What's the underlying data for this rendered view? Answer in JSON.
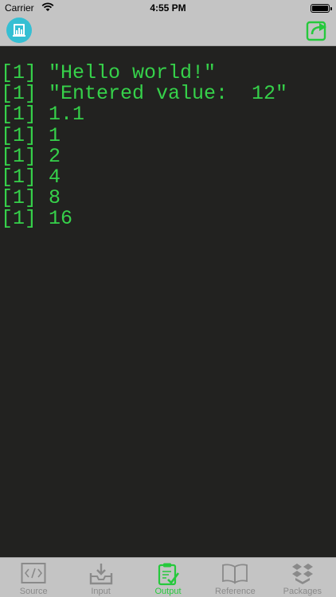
{
  "status_bar": {
    "carrier": "Carrier",
    "time": "4:55 PM"
  },
  "nav_bar": {
    "app_icon": "app-logo-icon",
    "share_icon": "share-icon",
    "accent": "#26c93c"
  },
  "console": {
    "text_color": "#36d14a",
    "background": "#222220",
    "lines": [
      "[1] \"Hello world!\"",
      "[1] \"Entered value:  12\"",
      "[1] 1.1",
      "[1] 1",
      "[1] 2",
      "[1] 4",
      "[1] 8",
      "[1] 16"
    ]
  },
  "tab_bar": {
    "active_color": "#26c93c",
    "inactive_color": "#8a8a8a",
    "tabs": [
      {
        "label": "Source",
        "icon": "code-icon",
        "active": false
      },
      {
        "label": "Input",
        "icon": "download-tray-icon",
        "active": false
      },
      {
        "label": "Output",
        "icon": "clipboard-check-icon",
        "active": true
      },
      {
        "label": "Reference",
        "icon": "book-icon",
        "active": false
      },
      {
        "label": "Packages",
        "icon": "boxes-icon",
        "active": false
      }
    ]
  }
}
